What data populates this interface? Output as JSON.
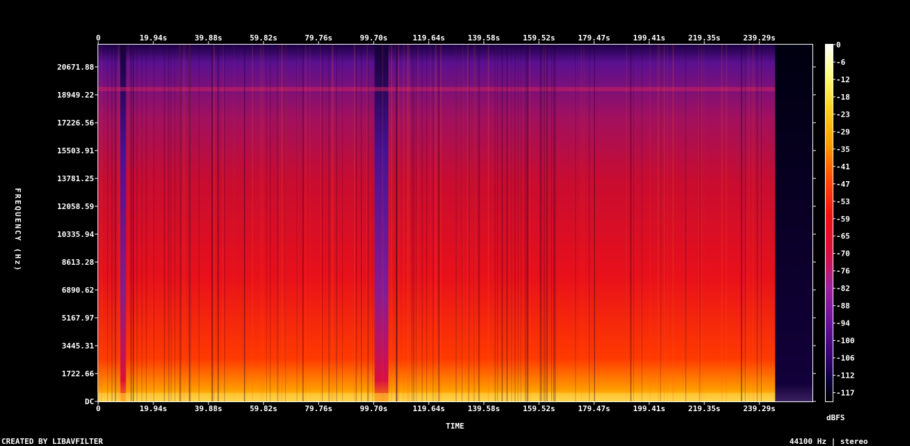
{
  "chart_data": {
    "type": "heatmap",
    "title": "",
    "xlabel": "TIME",
    "ylabel": "FREQUENCY (Hz)",
    "x_ticks": [
      "0",
      "19.94s",
      "39.88s",
      "59.82s",
      "79.76s",
      "99.70s",
      "119.64s",
      "139.58s",
      "159.52s",
      "179.47s",
      "199.41s",
      "219.35s",
      "239.29s"
    ],
    "x_tick_values": [
      0,
      19.94,
      39.88,
      59.82,
      79.76,
      99.7,
      119.64,
      139.58,
      159.52,
      179.47,
      199.41,
      219.35,
      239.29
    ],
    "xlim": [
      0,
      258.5
    ],
    "y_ticks": [
      "DC",
      "1722.66",
      "3445.31",
      "5167.97",
      "6890.62",
      "8613.28",
      "10335.94",
      "12058.59",
      "13781.25",
      "15503.91",
      "17226.56",
      "18949.22",
      "20671.88"
    ],
    "y_tick_values": [
      0,
      1722.66,
      3445.31,
      5167.97,
      6890.62,
      8613.28,
      10335.94,
      12058.59,
      13781.25,
      15503.91,
      17226.56,
      18949.22,
      20671.88
    ],
    "ylim": [
      0,
      22050
    ],
    "colorbar": {
      "label": "dBFS",
      "ticks": [
        "0",
        "-6",
        "-12",
        "-18",
        "-23",
        "-29",
        "-35",
        "-41",
        "-47",
        "-53",
        "-59",
        "-65",
        "-70",
        "-76",
        "-82",
        "-88",
        "-94",
        "-100",
        "-106",
        "-112",
        "-117"
      ],
      "range": [
        -120,
        0
      ],
      "colors": [
        "#000000",
        "#0b0040",
        "#3a007a",
        "#6a0fa0",
        "#a020a0",
        "#d8103c",
        "#f01010",
        "#ff4a00",
        "#ff9a00",
        "#ffd020",
        "#ffff80",
        "#ffffff"
      ]
    },
    "loud_segments_s": [
      [
        0,
        8
      ],
      [
        10,
        20
      ],
      [
        20,
        30
      ],
      [
        48,
        68
      ],
      [
        68,
        72
      ],
      [
        72,
        100
      ],
      [
        105,
        130
      ],
      [
        130,
        185
      ],
      [
        185,
        245
      ]
    ],
    "quiet_segments_s": [
      [
        8,
        10
      ],
      [
        100,
        105
      ],
      [
        245,
        258.5
      ]
    ]
  },
  "footer": {
    "created_by": "CREATED BY LIBAVFILTER",
    "info": "44100 Hz | stereo"
  }
}
